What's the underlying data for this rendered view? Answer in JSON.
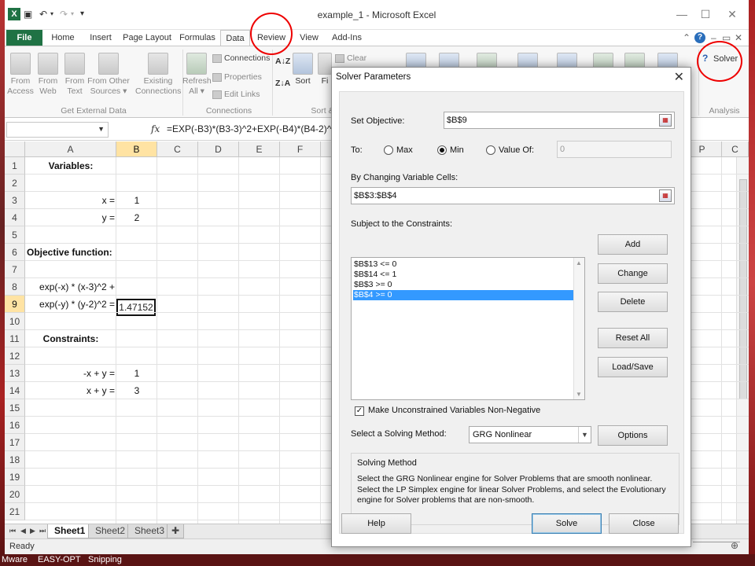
{
  "window": {
    "title": "example_1  -  Microsoft Excel",
    "min": "—",
    "max": "☐",
    "close": "✕"
  },
  "ribbon_tabs": [
    "File",
    "Home",
    "Insert",
    "Page Layout",
    "Formulas",
    "Data",
    "Review",
    "View",
    "Add-Ins"
  ],
  "ribbon": {
    "from_access": "From\nAccess",
    "from_web": "From\nWeb",
    "from_text": "From\nText",
    "from_other": "From Other\nSources ▾",
    "existing": "Existing\nConnections",
    "refresh": "Refresh\nAll ▾",
    "connections": "Connections",
    "properties": "Properties",
    "edit_links": "Edit Links",
    "sort": "Sort",
    "filter_short": "Fi",
    "clear": "Clear",
    "group_external": "Get External Data",
    "group_connections": "Connections",
    "group_sort": "Sort &",
    "group_analysis": "Analysis",
    "solver": "Solver"
  },
  "formula_bar": {
    "fx": "fx",
    "formula": "=EXP(-B3)*(B3-3)^2+EXP(-B4)*(B4-2)^2"
  },
  "grid": {
    "columns": [
      "A",
      "B",
      "C",
      "D",
      "E",
      "F",
      "P",
      "C"
    ],
    "rows": [
      "1",
      "2",
      "3",
      "4",
      "5",
      "6",
      "7",
      "8",
      "9",
      "10",
      "11",
      "12",
      "13",
      "14",
      "15",
      "16",
      "17",
      "18",
      "19",
      "20",
      "21"
    ],
    "cells": {
      "a1": "Variables:",
      "a3": "x =",
      "b3": "1",
      "a4": "y =",
      "b4": "2",
      "a6": "Objective function:",
      "a8": "exp(-x) * (x-3)^2 +",
      "a9": "exp(-y) * (y-2)^2 =",
      "b9": "1.47152",
      "a11": "Constraints:",
      "a13": "-x + y =",
      "b13": "1",
      "a14": "x + y =",
      "b14": "3"
    }
  },
  "sheets": [
    "Sheet1",
    "Sheet2",
    "Sheet3"
  ],
  "status": {
    "ready": "Ready"
  },
  "taskbar": [
    "Mware",
    "EASY-OPT",
    "Snipping"
  ],
  "dialog": {
    "title": "Solver Parameters",
    "set_objective_label": "Set Objective:",
    "set_objective_value": "$B$9",
    "to_label": "To:",
    "max": "Max",
    "min": "Min",
    "value_of": "Value Of:",
    "value_of_value": "0",
    "changing_label": "By Changing Variable Cells:",
    "changing_value": "$B$3:$B$4",
    "constraints_label": "Subject to the Constraints:",
    "constraints": [
      "$B$13 <= 0",
      "$B$14 <= 1",
      "$B$3 >= 0",
      "$B$4 >= 0"
    ],
    "add": "Add",
    "change": "Change",
    "delete": "Delete",
    "reset_all": "Reset All",
    "load_save": "Load/Save",
    "nonneg_label": "Make Unconstrained Variables Non-Negative",
    "method_label": "Select a Solving Method:",
    "method_value": "GRG Nonlinear",
    "options": "Options",
    "method_title": "Solving Method",
    "method_desc": "Select the GRG Nonlinear engine for Solver Problems that are smooth nonlinear. Select the LP Simplex engine for linear Solver Problems, and select the Evolutionary engine for Solver problems that are non-smooth.",
    "help": "Help",
    "solve": "Solve",
    "close": "Close"
  }
}
